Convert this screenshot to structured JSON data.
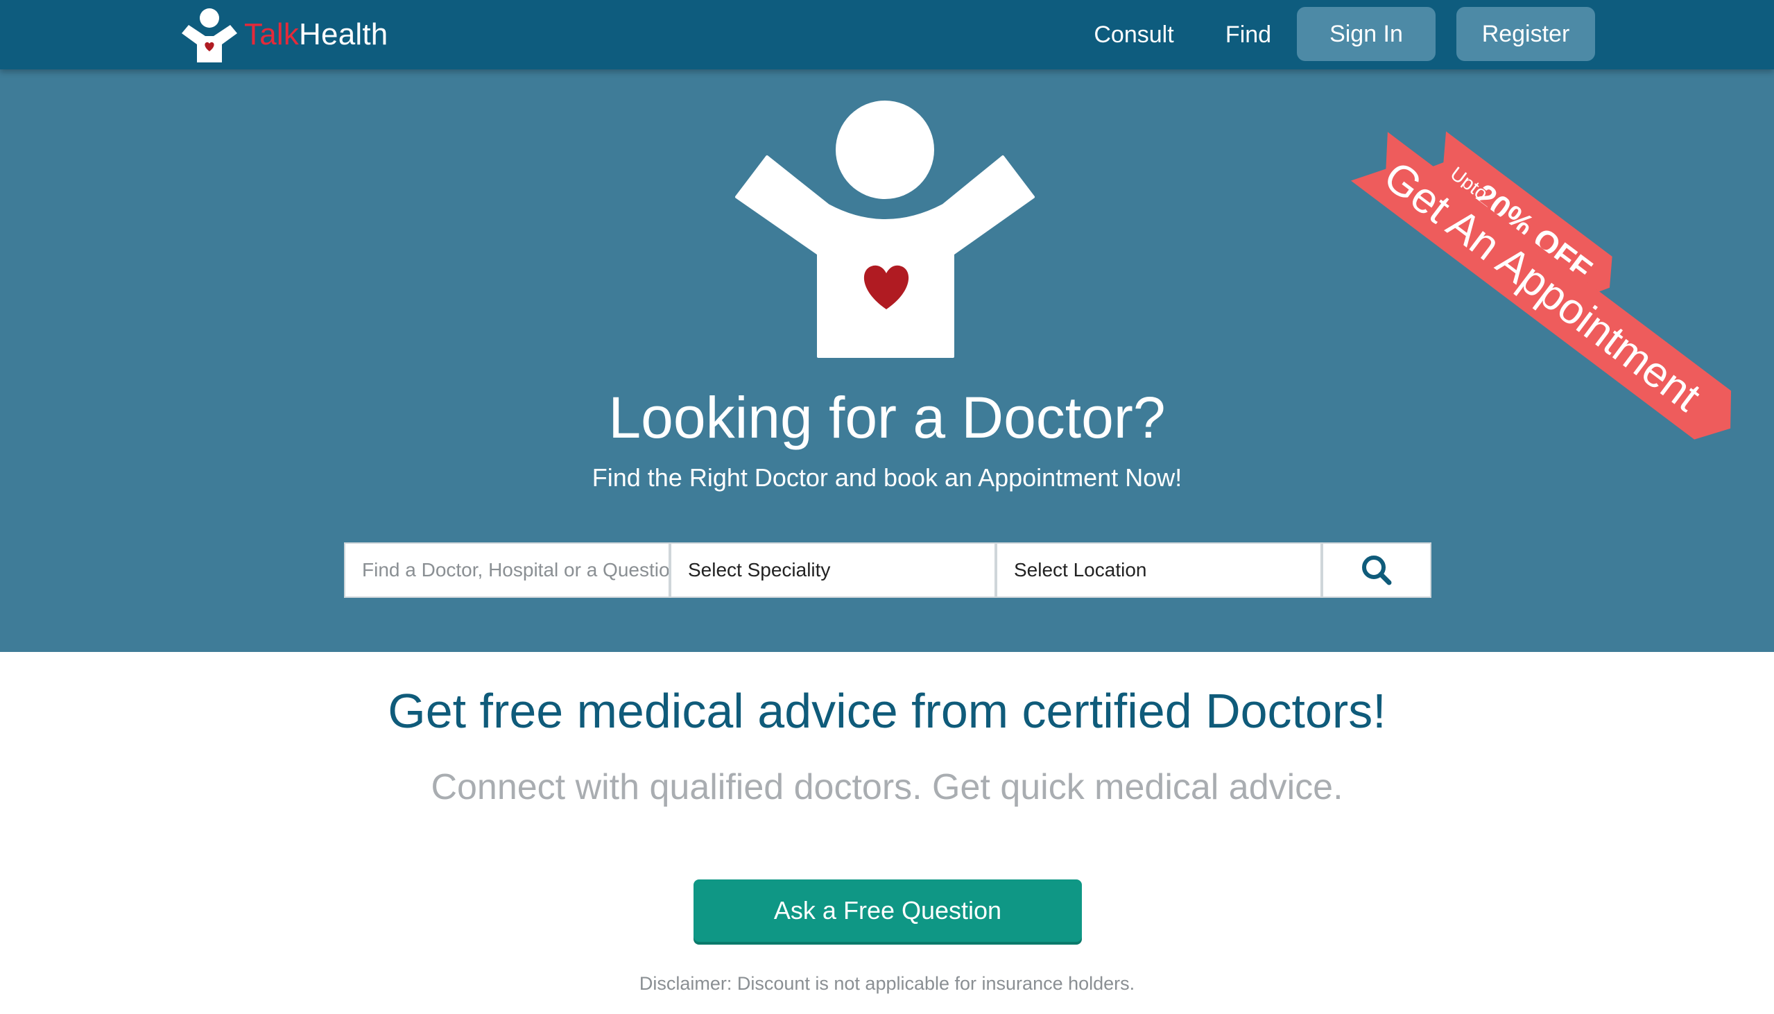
{
  "navbar": {
    "brand_talk": "Talk",
    "brand_health": "Health",
    "brand_icon": "talkhealth-person-heart-logo",
    "links": {
      "consult": "Consult",
      "find": "Find"
    },
    "buttons": {
      "sign_in": "Sign In",
      "register": "Register"
    }
  },
  "hero": {
    "figure_icon": "person-heart-icon",
    "title": "Looking for a Doctor?",
    "subtitle": "Find the Right Doctor and book an Appointment Now!",
    "search": {
      "placeholder": "Find a Doctor, Hospital or a Question",
      "speciality": "Select Speciality",
      "location": "Select Location",
      "button_icon": "search-icon"
    },
    "ribbon": {
      "small_upto": "Upto",
      "small_offer": "20% OFF",
      "large": "Get An Appointment"
    }
  },
  "lower": {
    "title": "Get free medical advice from certified Doctors!",
    "subtitle": "Connect with qualified doctors. Get quick medical advice.",
    "ask_button": "Ask a Free Question",
    "disclaimer": "Disclaimer: Discount is not applicable for insurance holders."
  },
  "colors": {
    "navbar": "#0e5c7e",
    "hero": "#3f7c98",
    "nav_button": "#4d8aa6",
    "ribbon": "#ee5c5c",
    "heart": "#b01b22",
    "brand_red": "#e42a3a",
    "cta": "#0f9785",
    "title_blue": "#0f5b7a"
  }
}
